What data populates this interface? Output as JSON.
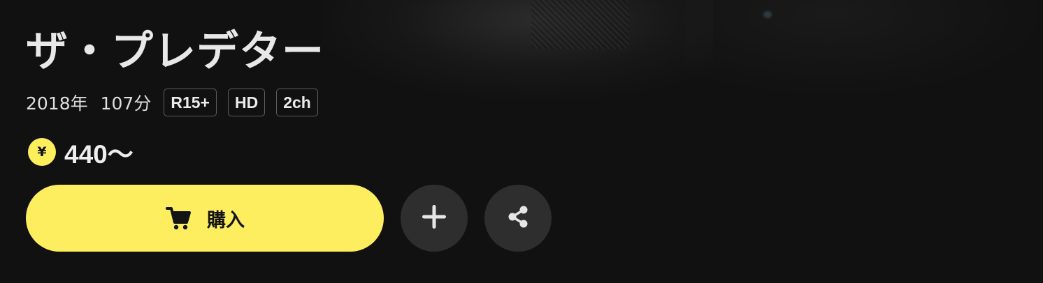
{
  "title": "ザ・プレデター",
  "meta": {
    "year": "2018年",
    "duration": "107分",
    "badges": [
      "R15+",
      "HD",
      "2ch"
    ]
  },
  "price": {
    "icon": "yen-coin-icon",
    "currency_symbol": "¥",
    "value": "440〜"
  },
  "actions": {
    "buy_label": "購入",
    "buy_icon": "cart-icon",
    "add_icon": "plus-icon",
    "share_icon": "share-icon"
  },
  "colors": {
    "background": "#111111",
    "accent": "#fdee5f",
    "circle_button": "#2e2e2e",
    "text": "#e8e8e8"
  }
}
